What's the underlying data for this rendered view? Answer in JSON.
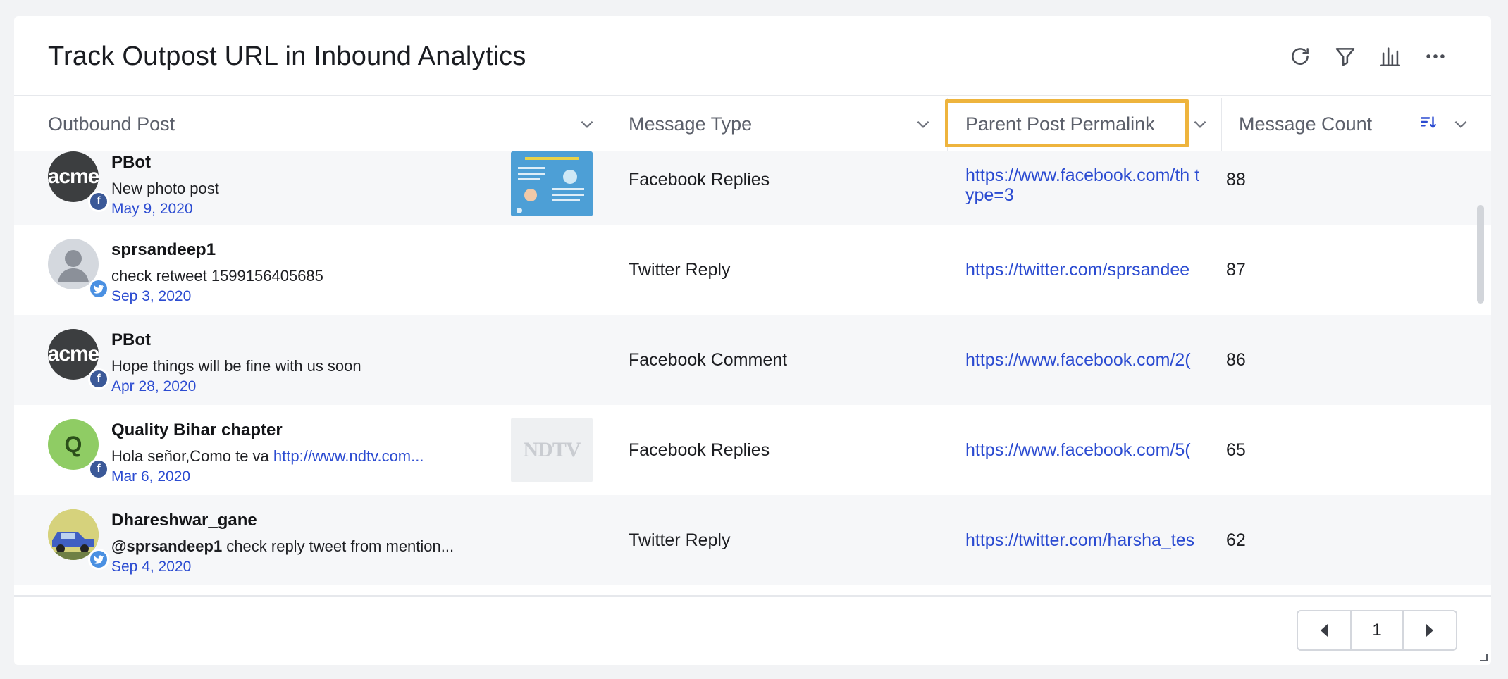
{
  "widget": {
    "title": "Track Outpost URL in Inbound Analytics",
    "toolbar": [
      "refresh-icon",
      "filter-icon",
      "chart-icon",
      "more-icon"
    ]
  },
  "columns": [
    {
      "label": "Outbound Post"
    },
    {
      "label": "Message Type"
    },
    {
      "label": "Parent Post Permalink"
    },
    {
      "label": "Message Count"
    }
  ],
  "rows": [
    {
      "author": "PBot",
      "avatar_text": "acme",
      "network": "facebook",
      "message": "New photo post",
      "date": "May 9, 2020",
      "message_type": "Facebook Replies",
      "permalink": "https://www.facebook.com/th type=3",
      "count": "88"
    },
    {
      "author": "sprsandeep1",
      "avatar_text": "",
      "network": "twitter",
      "message": "check retweet 1599156405685",
      "date": "Sep 3, 2020",
      "message_type": "Twitter Reply",
      "permalink": "https://twitter.com/sprsandee",
      "count": "87"
    },
    {
      "author": "PBot",
      "avatar_text": "acme",
      "network": "facebook",
      "message": "Hope things will be fine with us soon",
      "date": "Apr 28, 2020",
      "message_type": "Facebook Comment",
      "permalink": "https://www.facebook.com/2(",
      "count": "86"
    },
    {
      "author": "Quality Bihar chapter",
      "avatar_text": "Q",
      "network": "facebook",
      "message": "Hola señor,Como te va ",
      "message_link": "http://www.ndtv.com...",
      "date": "Mar 6, 2020",
      "message_type": "Facebook Replies",
      "permalink": "https://www.facebook.com/5(",
      "count": "65"
    },
    {
      "author": "Dhareshwar_gane",
      "avatar_text": "",
      "network": "twitter",
      "message_mention": "@sprsandeep1",
      "message": " check reply tweet from mention...",
      "date": "Sep 4, 2020",
      "message_type": "Twitter Reply",
      "permalink": "https://twitter.com/harsha_tes",
      "count": "62"
    }
  ],
  "thumb_ndtv_text": "NDTV",
  "pagination": {
    "page": "1"
  },
  "colors": {
    "accent": "#2b4bd1",
    "highlight": "#eeb43d",
    "facebook": "#3b5998",
    "twitter": "#4a90e2"
  }
}
